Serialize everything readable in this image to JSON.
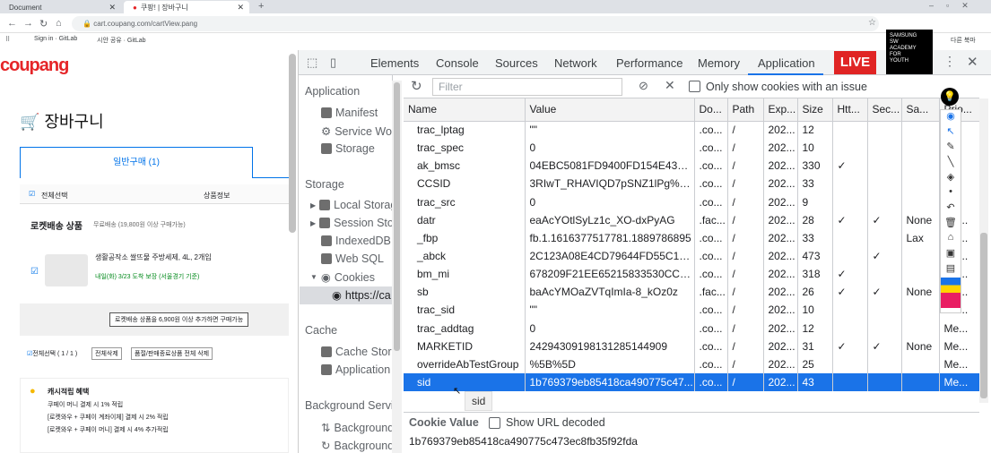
{
  "browser": {
    "tabs": [
      {
        "label": "Document"
      },
      {
        "label": "쿠팡! | 장바구니"
      }
    ],
    "address": "cart.coupang.com/cartView.pang",
    "bookmarks": [
      "Sign in · GitLab",
      "시안 공유 · GitLab"
    ],
    "other_bookmarks": "다른 북마"
  },
  "coupang": {
    "logo": "coupang",
    "title": "장바구니",
    "tab_general": "일반구매 (1)",
    "select_all": "전체선택",
    "product_info": "상품정보",
    "rocket_title": "로켓배송 상품",
    "rocket_note": "무료배송 (19,800원 이상 구매가능)",
    "item_name": "생활공작소 쌀뜨물 주방세제, 4L, 2개입",
    "item_delivery": "내일(화) 3/23 도착 보장 (서울경기 기준)",
    "rocket_notice": "로켓배송 상품을 6,900원 이상 추가하면 구매가능",
    "select_bottom": "전체선택 ( 1 / 1 )",
    "delete_all": "전체삭제",
    "delete_soldout": "품절/판매종료상품 전체 삭제",
    "cash_title": "캐시적립 혜택",
    "cash_lines": [
      "쿠페이 머니 결제 시 1% 적립",
      "[로켓와우 + 쿠페이 계좌이체] 결제 시 2% 적립",
      "[로켓와우 + 쿠페이 머니] 결제 시 4% 추가적립"
    ]
  },
  "devtools": {
    "tabs": [
      "Elements",
      "Console",
      "Sources",
      "Network",
      "Performance",
      "Memory",
      "Application"
    ],
    "active_tab": "Application",
    "sidebar": {
      "application_header": "Application",
      "application_items": [
        "Manifest",
        "Service Wor",
        "Storage"
      ],
      "storage_header": "Storage",
      "storage_items": [
        "Local Storag",
        "Session Stor",
        "IndexedDB",
        "Web SQL",
        "Cookies",
        "https://ca"
      ],
      "cache_header": "Cache",
      "cache_items": [
        "Cache Stora",
        "Application"
      ],
      "bg_header": "Background Servic",
      "bg_items": [
        "Background",
        "Background"
      ]
    },
    "filter_placeholder": "Filter",
    "only_issue_label": "Only show cookies with an issue",
    "columns": [
      "Name",
      "Value",
      "Do...",
      "Path",
      "Exp...",
      "Size",
      "Htt...",
      "Sec...",
      "Sa...",
      "Prio..."
    ],
    "rows": [
      [
        "trac_lptag",
        "\"\"",
        ".co...",
        "/",
        "202...",
        "12",
        "",
        "",
        "",
        ""
      ],
      [
        "trac_spec",
        "0",
        ".co...",
        "/",
        "202...",
        "10",
        "",
        "",
        "",
        ""
      ],
      [
        "ak_bmsc",
        "04EBC5081FD9400FD154E432D...",
        ".co...",
        "/",
        "202...",
        "330",
        "✓",
        "",
        "",
        ""
      ],
      [
        "CCSID",
        "3RIwT_RHAVIQD7pSNZ1lPg%3D...",
        ".co...",
        "/",
        "202...",
        "33",
        "",
        "",
        "",
        ""
      ],
      [
        "trac_src",
        "0",
        ".co...",
        "/",
        "202...",
        "9",
        "",
        "",
        "",
        ""
      ],
      [
        "datr",
        "eaAcYOtlSyLz1c_XO-dxPyAG",
        ".fac...",
        "/",
        "202...",
        "28",
        "✓",
        "✓",
        "None",
        "Me..."
      ],
      [
        "_fbp",
        "fb.1.1616377517781.1889786895",
        ".co...",
        "/",
        "202...",
        "33",
        "",
        "",
        "Lax",
        "Me..."
      ],
      [
        "_abck",
        "2C123A08E4CD79644FD55C199...",
        ".co...",
        "/",
        "202...",
        "473",
        "",
        "✓",
        "",
        "Me..."
      ],
      [
        "bm_mi",
        "678209F21EE65215833530CCE5...",
        ".co...",
        "/",
        "202...",
        "318",
        "✓",
        "",
        "",
        "Me..."
      ],
      [
        "sb",
        "baAcYMOaZVTqImIa-8_kOz0z",
        ".fac...",
        "/",
        "202...",
        "26",
        "✓",
        "✓",
        "None",
        "Me..."
      ],
      [
        "trac_sid",
        "\"\"",
        ".co...",
        "/",
        "202...",
        "10",
        "",
        "",
        "",
        "Me..."
      ],
      [
        "trac_addtag",
        "0",
        ".co...",
        "/",
        "202...",
        "12",
        "",
        "",
        "",
        "Me..."
      ],
      [
        "MARKETID",
        "2429430919813128514490­9",
        ".co...",
        "/",
        "202...",
        "31",
        "✓",
        "✓",
        "None",
        "Me..."
      ],
      [
        "overrideAbTestGroup",
        "%5B%5D",
        ".co...",
        "/",
        "202...",
        "25",
        "",
        "",
        "",
        "Me..."
      ],
      [
        "sid",
        "1b769379eb85418ca490775c47...",
        ".co...",
        "/",
        "202...",
        "43",
        "",
        "",
        "",
        "Me..."
      ]
    ],
    "selected_row": 14,
    "tooltip": "sid",
    "cookie_value_label": "Cookie Value",
    "show_url_decoded": "Show URL decoded",
    "cookie_value": "1b769379eb85418ca490775c473ec8fb35f92fda"
  },
  "overlay": {
    "live": "LIVE",
    "samsung": [
      "SAMSUNG",
      "SW",
      "ACADEMY",
      "FOR",
      "YOUTH"
    ]
  },
  "colors": {
    "accent": "#1a73e8",
    "live_red": "#e02424",
    "coupang_red": "#e52528"
  }
}
